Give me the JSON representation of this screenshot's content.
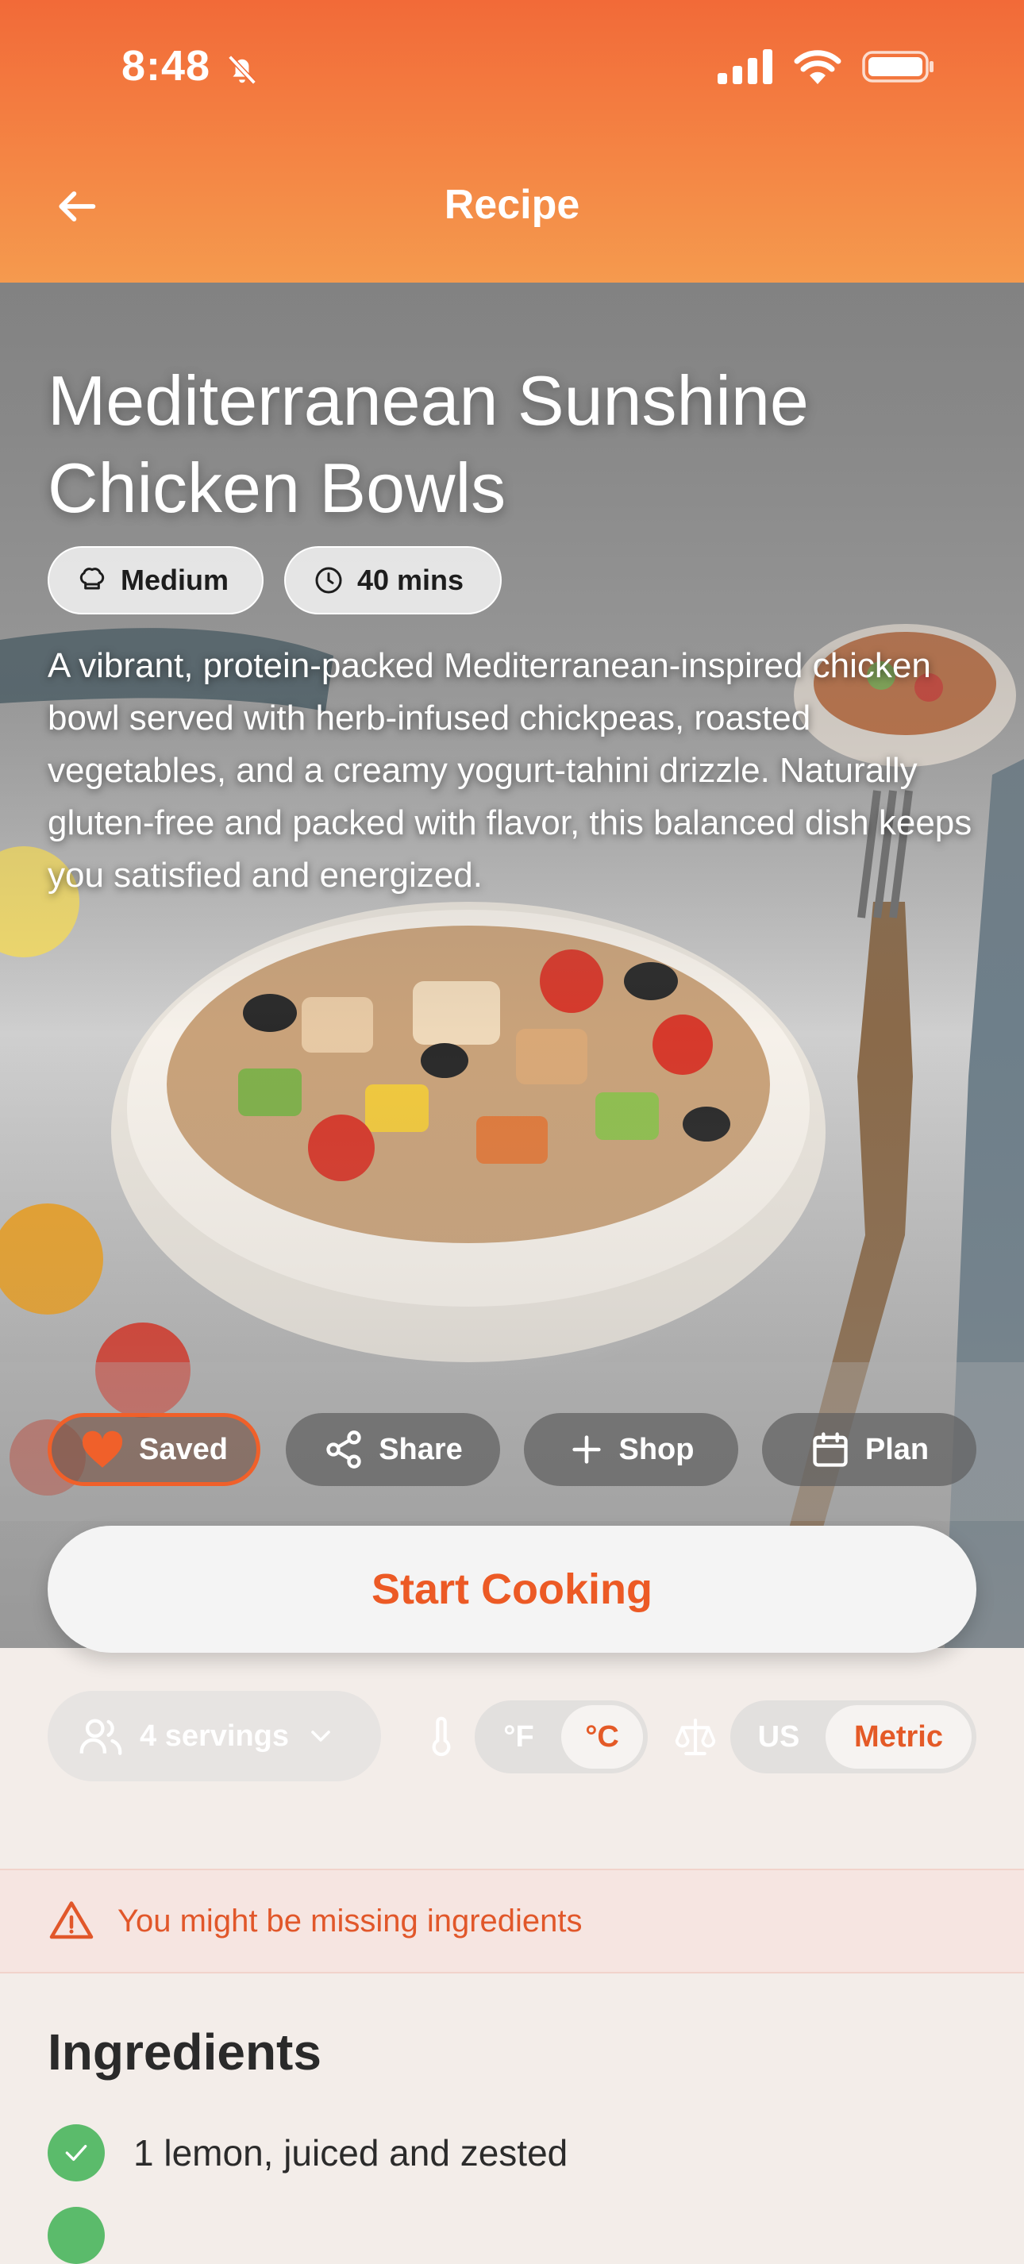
{
  "status_bar": {
    "time": "8:48"
  },
  "header": {
    "title": "Recipe"
  },
  "recipe": {
    "title": "Mediterranean Sunshine Chicken Bowls",
    "difficulty": "Medium",
    "duration": "40 mins",
    "description": "A vibrant, protein-packed Mediterranean-inspired chicken bowl served with herb-infused chickpeas, roasted vegetables, and a creamy yogurt-tahini drizzle. Naturally gluten-free and packed with flavor, this balanced dish keeps you satisfied and energized."
  },
  "actions": {
    "saved_label": "Saved",
    "share_label": "Share",
    "shop_label": "Shop",
    "plan_label": "Plan",
    "start_label": "Start Cooking"
  },
  "settings": {
    "servings_label": "4 servings",
    "temperature_options": [
      "°F",
      "°C"
    ],
    "temperature_selected": "°C",
    "measure_options": [
      "US",
      "Metric"
    ],
    "measure_selected": "Metric"
  },
  "alert": {
    "text": "You might be missing ingredients"
  },
  "ingredients": {
    "title": "Ingredients",
    "items": [
      {
        "text": "1 lemon, juiced and zested",
        "checked": true
      },
      {
        "text": "",
        "checked": true
      }
    ]
  },
  "colors": {
    "accent": "#F0602A",
    "header_top": "#F26A38",
    "header_bottom": "#F59A4E",
    "check_green": "#5BBB6B"
  }
}
